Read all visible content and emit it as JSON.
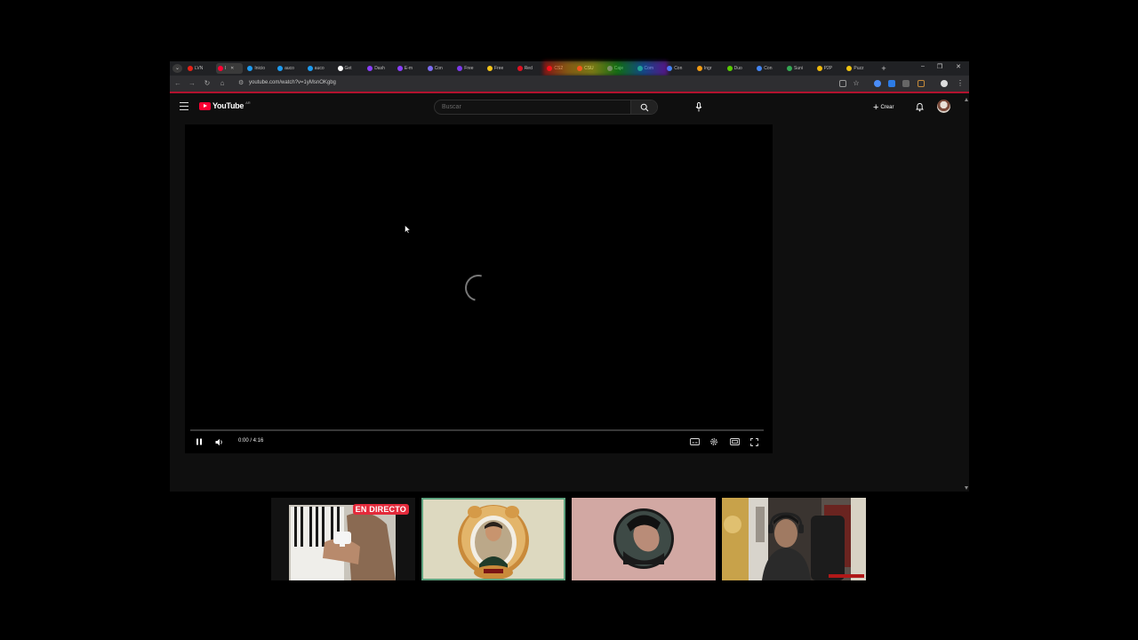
{
  "browser": {
    "tabs": [
      {
        "label": "LVN",
        "color": "#e62117"
      },
      {
        "label": "I",
        "color": "#ff0033",
        "active": true
      },
      {
        "label": "Inicio",
        "color": "#1d9bf0"
      },
      {
        "label": "auco",
        "color": "#1d9bf0"
      },
      {
        "label": "auco",
        "color": "#1d9bf0"
      },
      {
        "label": "Get",
        "color": "#ffffff"
      },
      {
        "label": "Dash",
        "color": "#8a3ffc"
      },
      {
        "label": "E-m",
        "color": "#8a3ffc"
      },
      {
        "label": "Con",
        "color": "#7c6cf0"
      },
      {
        "label": "Free",
        "color": "#7c3aed"
      },
      {
        "label": "Free",
        "color": "#f5c518"
      },
      {
        "label": "Red",
        "color": "#d12"
      },
      {
        "label": "CS2",
        "color": "#e03"
      },
      {
        "label": "CSU",
        "color": "#e03"
      },
      {
        "label": "Caje",
        "color": "#9b59b6"
      },
      {
        "label": "Com",
        "color": "#3dbb5d"
      },
      {
        "label": "Con",
        "color": "#4285f4"
      },
      {
        "label": "Ingr",
        "color": "#f39c12"
      },
      {
        "label": "Duo",
        "color": "#58cc02"
      },
      {
        "label": "Con",
        "color": "#4285f4"
      },
      {
        "label": "Suni",
        "color": "#34a853"
      },
      {
        "label": "P2P",
        "color": "#f0b90b"
      },
      {
        "label": "Puzz",
        "color": "#f1c40f"
      }
    ],
    "url": "youtube.com/watch?v=1yMsnOKgbg",
    "window_controls": {
      "minimize": "–",
      "restore": "❐",
      "close": "✕"
    }
  },
  "youtube": {
    "logo_text": "YouTube",
    "logo_region": "AR",
    "search_placeholder": "Buscar",
    "create_label": "Crear"
  },
  "player": {
    "time": "0:00 / 4:16",
    "progress": 0,
    "state": "loading"
  },
  "webcams": {
    "live_badge": "EN DIRECTO"
  },
  "colors": {
    "brand_red": "#ff0033",
    "live_red": "#e32a3b",
    "active_cam_border": "#5fa37f"
  }
}
